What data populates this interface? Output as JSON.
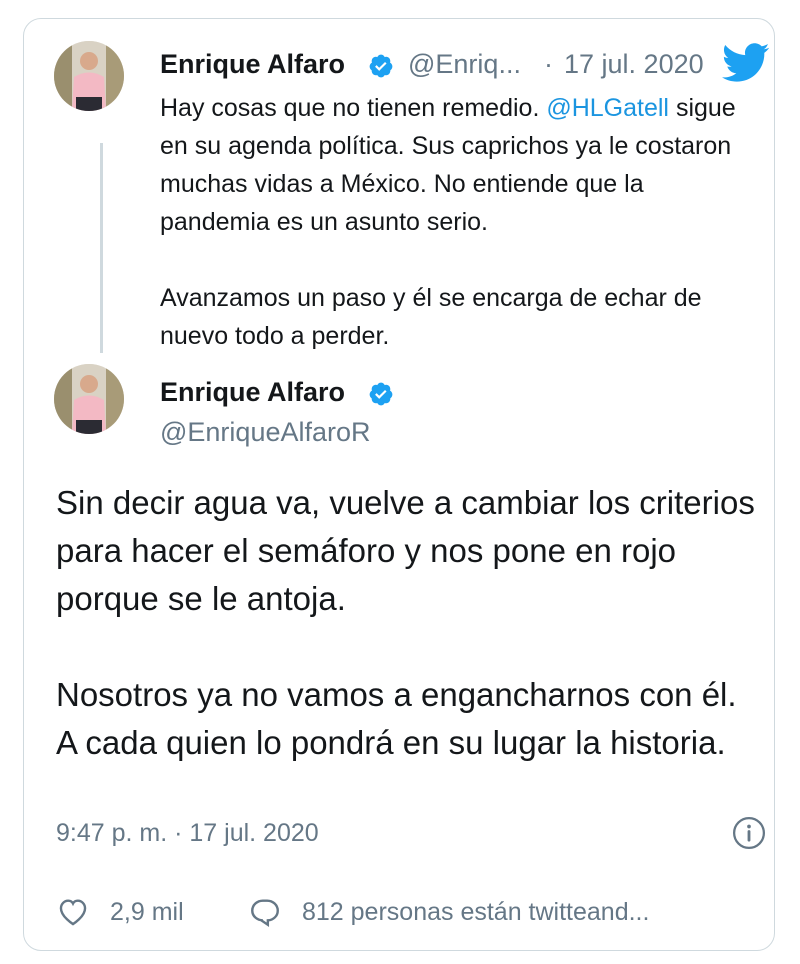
{
  "quoted_tweet": {
    "author_name": "Enrique Alfaro",
    "handle": "@Enriq...",
    "separator": "·",
    "date": "17 jul. 2020",
    "text_prefix": "Hay cosas que no tienen remedio. ",
    "mention": "@HLGatell",
    "text_rest": " sigue en su agenda política. Sus caprichos ya le costaron muchas vidas a México. No entiende que la pandemia es un asunto serio.",
    "paragraph2": "Avanzamos un paso y él se encarga de echar de nuevo todo a perder."
  },
  "main_tweet": {
    "author_name": "Enrique Alfaro",
    "handle": "@EnriqueAlfaroR",
    "paragraph1": "Sin decir agua va, vuelve a cambiar los criterios para hacer el semáforo y nos pone en rojo porque se le antoja.",
    "paragraph2": "Nosotros ya no vamos a engancharnos con él. A cada quien lo pondrá en su lugar la historia.",
    "timestamp": "9:47 p. m. · 17 jul. 2020"
  },
  "actions": {
    "likes": "2,9 mil",
    "conversation": "812 personas están twitteand..."
  },
  "icons": {
    "verified": "verified-badge-icon",
    "brand": "twitter-bird-icon",
    "info": "info-icon",
    "like": "heart-icon",
    "reply": "speech-bubble-icon"
  },
  "colors": {
    "brand_blue": "#1da1f2",
    "mention_blue": "#1b95e0",
    "muted_text": "#657786",
    "border": "#cfd9de"
  }
}
